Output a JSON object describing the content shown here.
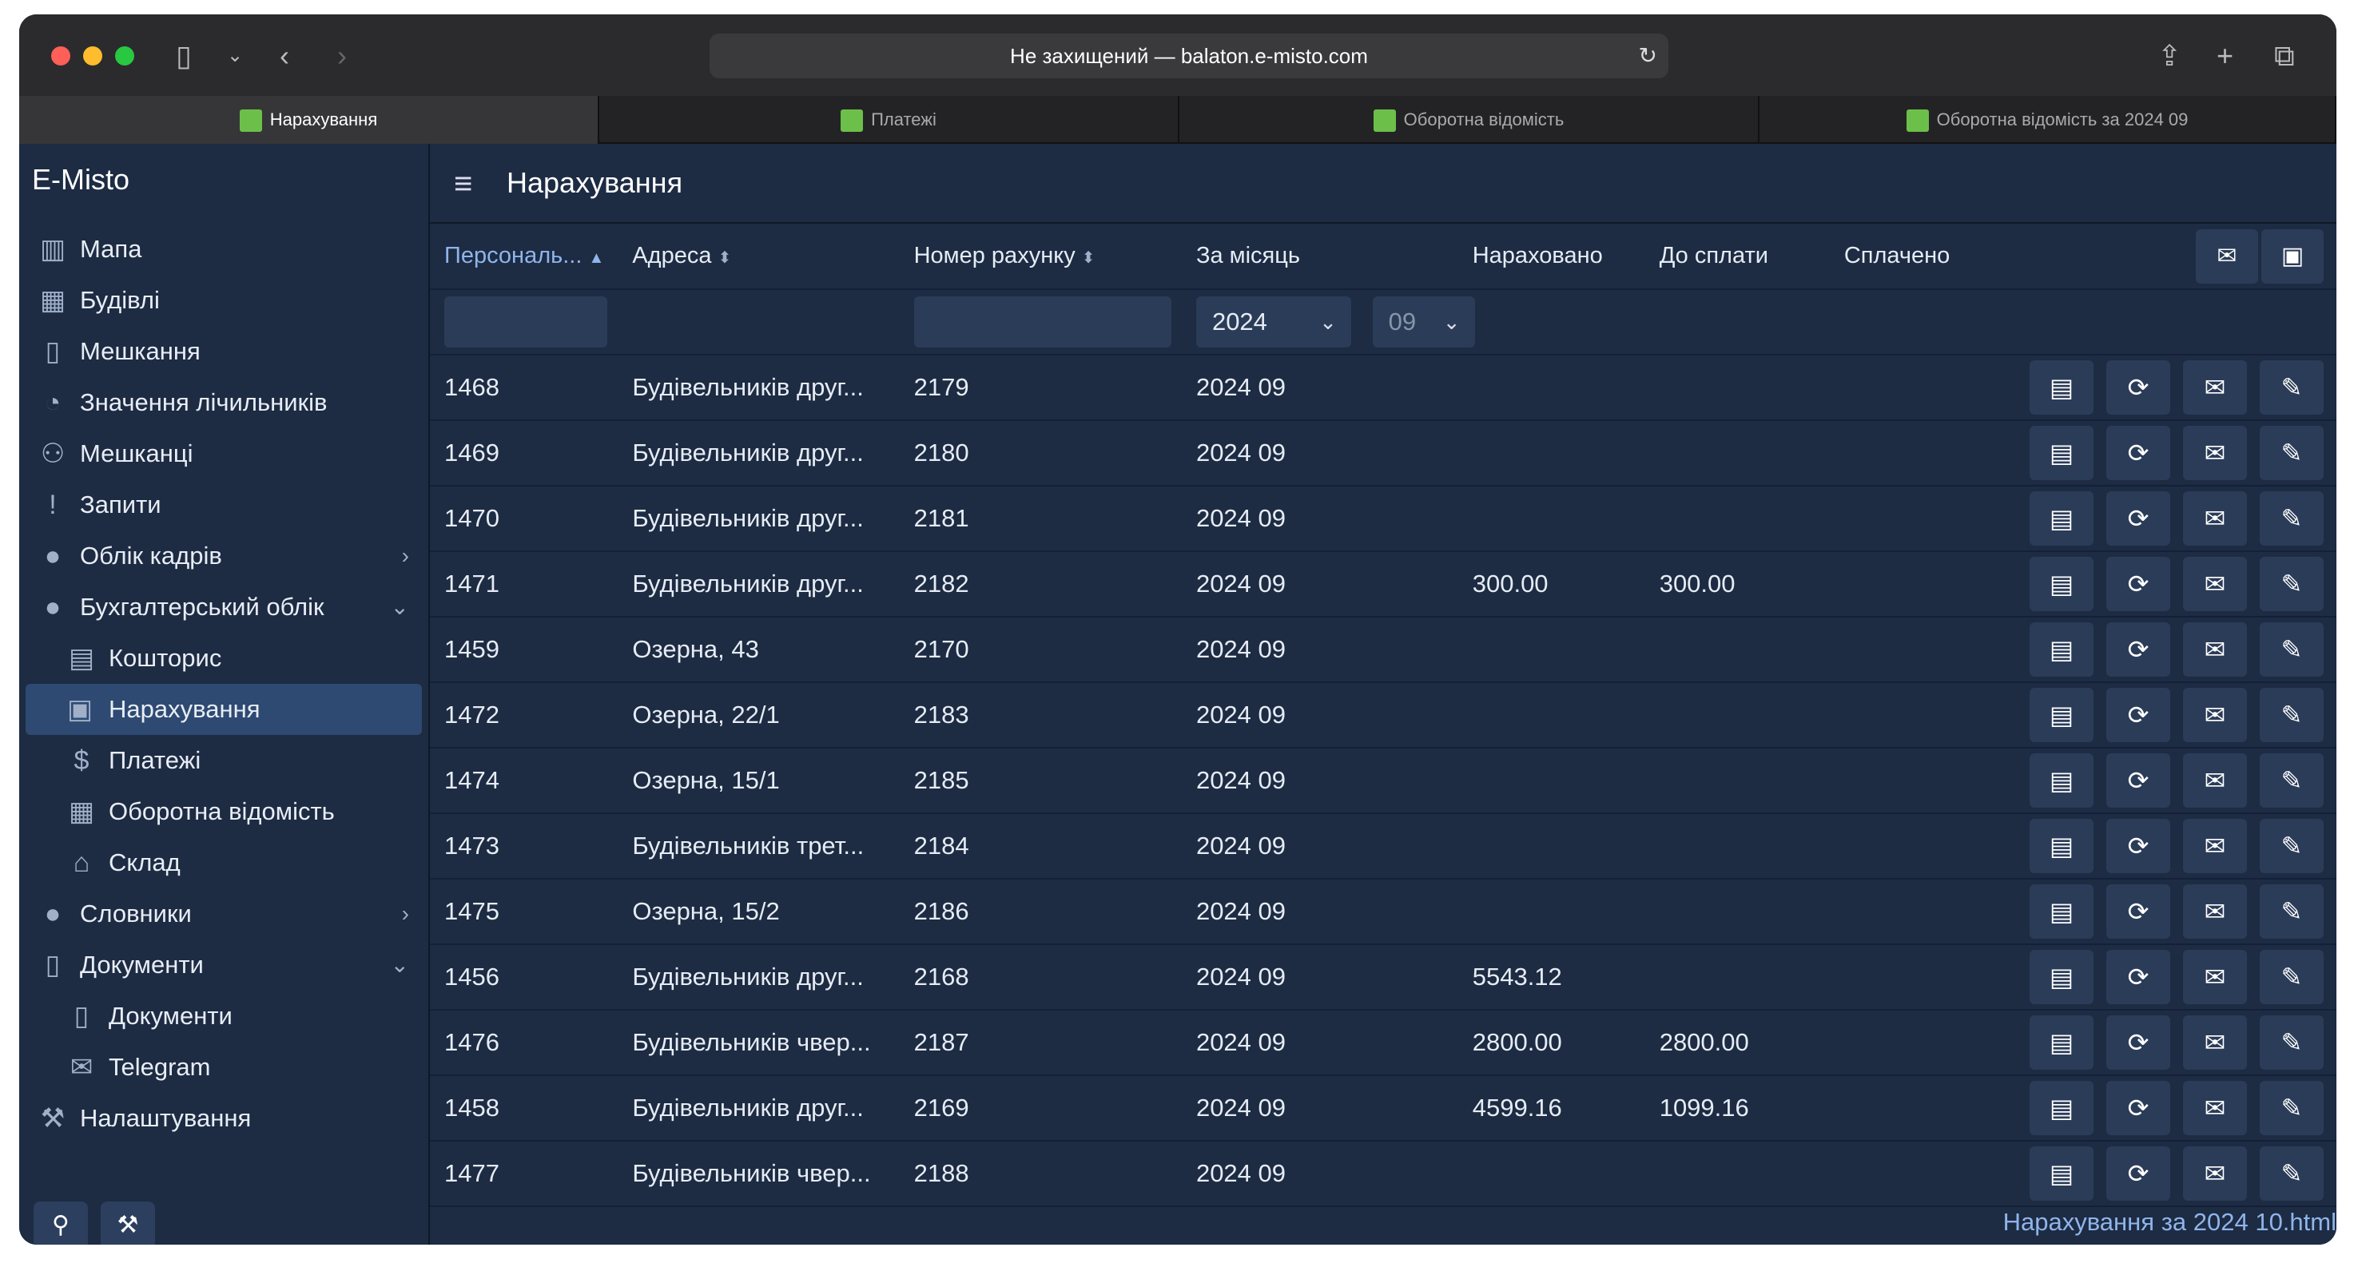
{
  "browser": {
    "address": "Не захищений — balaton.e-misto.com",
    "tabs": [
      "Нарахування",
      "Платежі",
      "Оборотна відомість",
      "Оборотна відомість за 2024 09"
    ]
  },
  "sidebar": {
    "brand": "E-Misto",
    "items": [
      {
        "label": "Мапа",
        "icon": "map-icon"
      },
      {
        "label": "Будівлі",
        "icon": "building-icon"
      },
      {
        "label": "Мешкання",
        "icon": "door-icon"
      },
      {
        "label": "Значення лічильників",
        "icon": "gauge-icon"
      },
      {
        "label": "Мешканці",
        "icon": "people-icon"
      },
      {
        "label": "Запити",
        "icon": "exclamation-icon"
      },
      {
        "label": "Облік кадрів",
        "icon": "globe-icon"
      },
      {
        "label": "Бухгалтерський облік",
        "icon": "globe-icon"
      },
      {
        "label": "Кошторис",
        "icon": "budget-icon"
      },
      {
        "label": "Нарахування",
        "icon": "invoice-icon"
      },
      {
        "label": "Платежі",
        "icon": "dollar-icon"
      },
      {
        "label": "Оборотна відомість",
        "icon": "table-icon"
      },
      {
        "label": "Склад",
        "icon": "warehouse-icon"
      },
      {
        "label": "Словники",
        "icon": "globe-icon"
      },
      {
        "label": "Документи",
        "icon": "file-icon"
      },
      {
        "label": "Документи",
        "icon": "document-icon"
      },
      {
        "label": "Telegram",
        "icon": "envelope-icon"
      },
      {
        "label": "Налаштування",
        "icon": "wrench-icon"
      }
    ]
  },
  "main": {
    "title": "Нарахування",
    "columns": [
      "Персональ...",
      "Адреса",
      "Номер рахунку",
      "За місяць",
      "Нараховано",
      "До сплати",
      "Сплачено"
    ],
    "filter_year": "2024",
    "filter_month": "09",
    "rows": [
      [
        "1468",
        "Будівельників друг...",
        "2179",
        "2024 09",
        "",
        ""
      ],
      [
        "1469",
        "Будівельників друг...",
        "2180",
        "2024 09",
        "",
        ""
      ],
      [
        "1470",
        "Будівельників друг...",
        "2181",
        "2024 09",
        "",
        ""
      ],
      [
        "1471",
        "Будівельників друг...",
        "2182",
        "2024 09",
        "300.00",
        "300.00"
      ],
      [
        "1459",
        "Озерна, 43",
        "2170",
        "2024 09",
        "",
        ""
      ],
      [
        "1472",
        "Озерна, 22/1",
        "2183",
        "2024 09",
        "",
        ""
      ],
      [
        "1474",
        "Озерна, 15/1",
        "2185",
        "2024 09",
        "",
        ""
      ],
      [
        "1473",
        "Будівельників трет...",
        "2184",
        "2024 09",
        "",
        ""
      ],
      [
        "1475",
        "Озерна, 15/2",
        "2186",
        "2024 09",
        "",
        ""
      ],
      [
        "1456",
        "Будівельників друг...",
        "2168",
        "2024 09",
        "5543.12",
        ""
      ],
      [
        "1476",
        "Будівельників чвер...",
        "2187",
        "2024 09",
        "2800.00",
        "2800.00"
      ],
      [
        "1458",
        "Будівельників друг...",
        "2169",
        "2024 09",
        "4599.16",
        "1099.16"
      ],
      [
        "1477",
        "Будівельників чвер...",
        "2188",
        "2024 09",
        "",
        ""
      ]
    ],
    "footer_link": "Нарахування за 2024 10.html"
  }
}
